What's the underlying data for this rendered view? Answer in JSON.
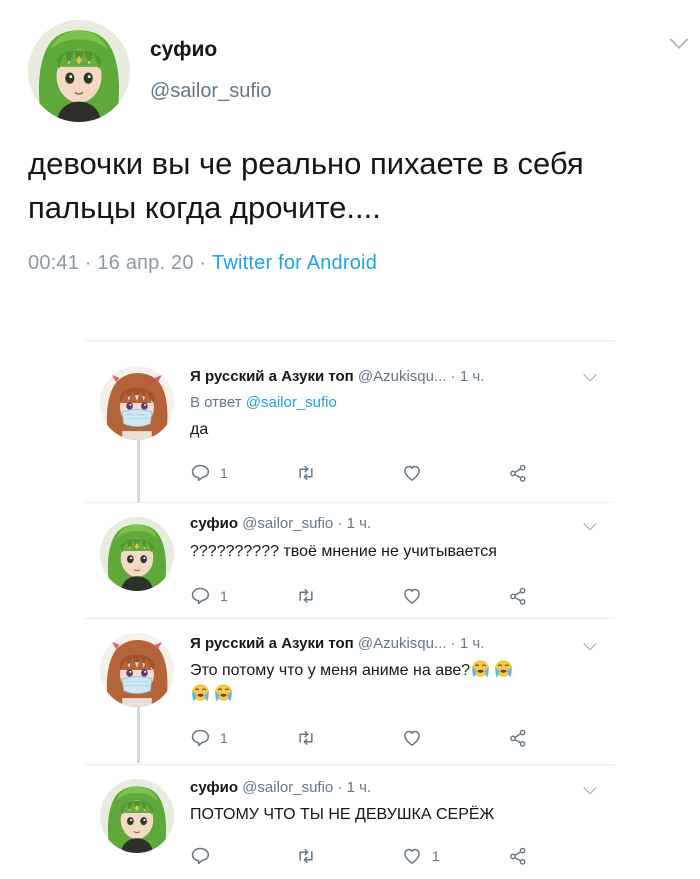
{
  "main": {
    "author_name": "суфио",
    "author_handle": "@sailor_sufio",
    "text": "девочки вы че реально пихаете в себя пальцы когда дрочите....",
    "meta_time": "00:41 · 16 апр. 20 · ",
    "meta_source": "Twitter for Android"
  },
  "replies": [
    {
      "name": "Я русский а Азуки топ",
      "handle": "@Azukisqu... · 1 ч.",
      "reply_prefix": "В ответ ",
      "reply_to": "@sailor_sufio",
      "text": "да",
      "reply_count": "1",
      "like_count": ""
    },
    {
      "name": "суфио",
      "handle": "@sailor_sufio · 1 ч.",
      "text": "?????????? твоё мнение не учитывается",
      "reply_count": "1",
      "like_count": ""
    },
    {
      "name": "Я русский а Азуки топ",
      "handle": "@Azukisqu... · 1 ч.",
      "text": "Это потому что у меня аниме на аве?",
      "emoji": "loudly-crying-face",
      "reply_count": "1",
      "like_count": ""
    },
    {
      "name": "суфио",
      "handle": "@sailor_sufio · 1 ч.",
      "text": "ПОТОМУ ЧТО ТЫ НЕ ДЕВУШКА СЕРЁЖ",
      "reply_count": "",
      "like_count": "1"
    }
  ],
  "colors": {
    "link": "#1da1f2",
    "secondary": "#657786",
    "thread_line": "#cfd6dc",
    "text": "#14171a"
  },
  "icons": [
    "chevron-down-icon",
    "reply-icon",
    "retweet-icon",
    "like-icon",
    "share-icon"
  ]
}
